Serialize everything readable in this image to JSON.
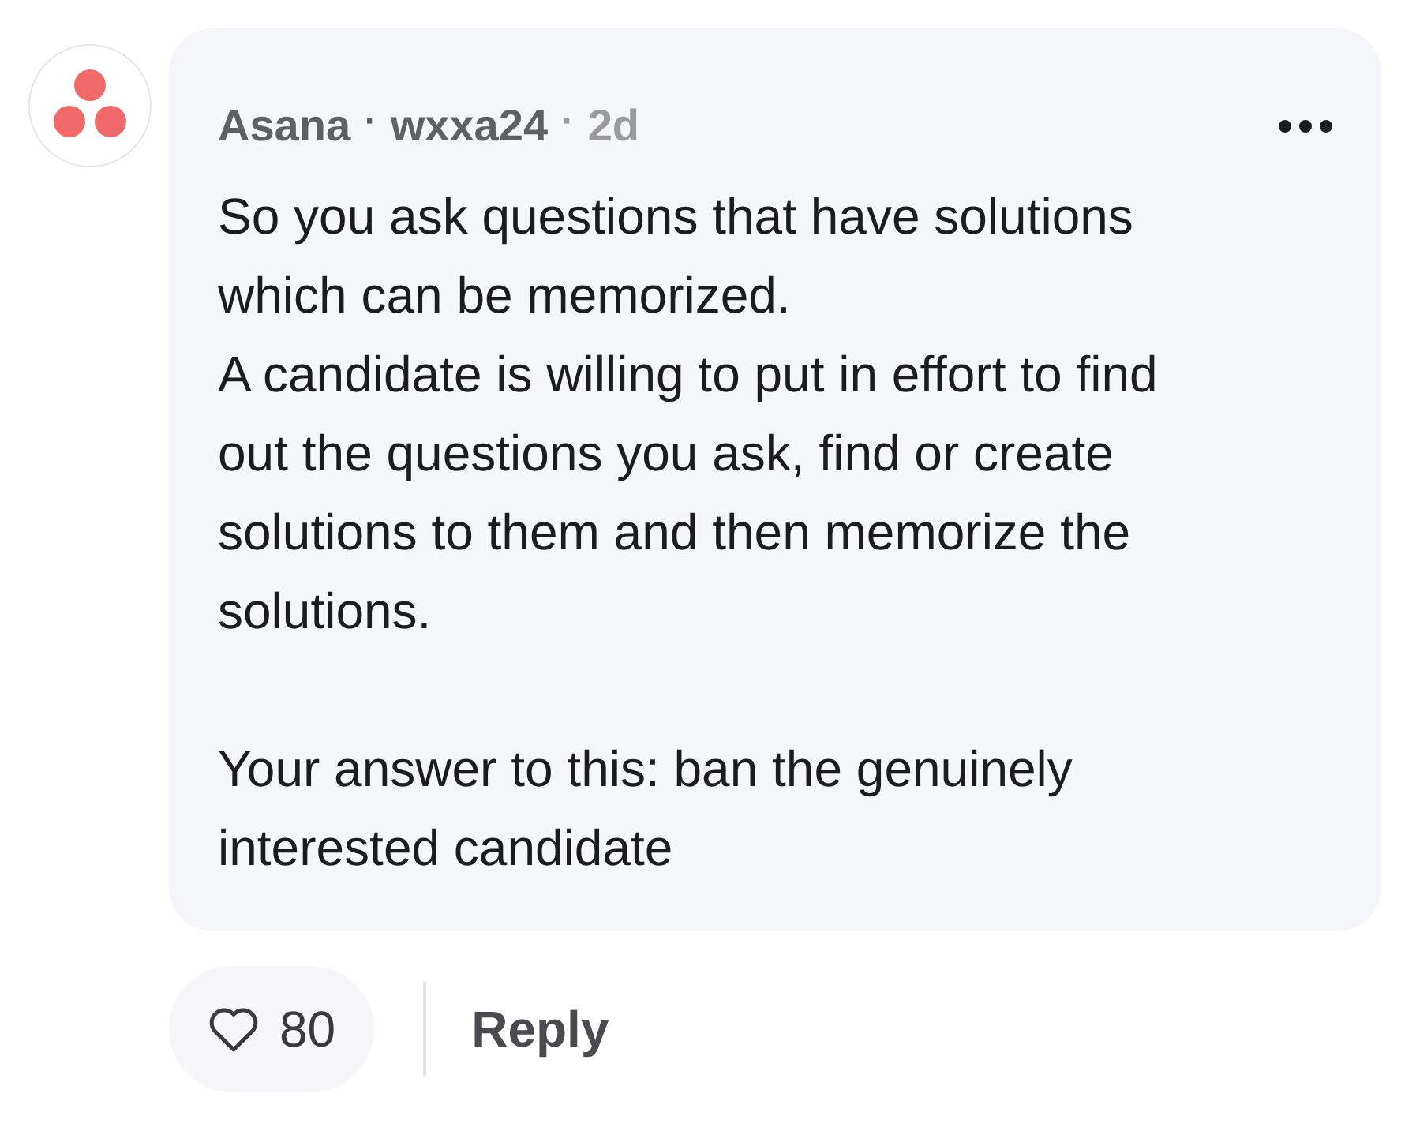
{
  "comment": {
    "community": "Asana",
    "separator_1": "·",
    "author": "wxxa24",
    "separator_2": "·",
    "age": "2d",
    "paragraphs": [
      "So you ask questions that have solutions which can be memorized.\nA candidate is willing to put in effort to find out the questions you ask, find or create solutions to them and then memorize the solutions.",
      "Your answer to this: ban the genuinely interested candidate"
    ]
  },
  "actions": {
    "like_count": "80",
    "liked": false,
    "reply": "Reply"
  }
}
